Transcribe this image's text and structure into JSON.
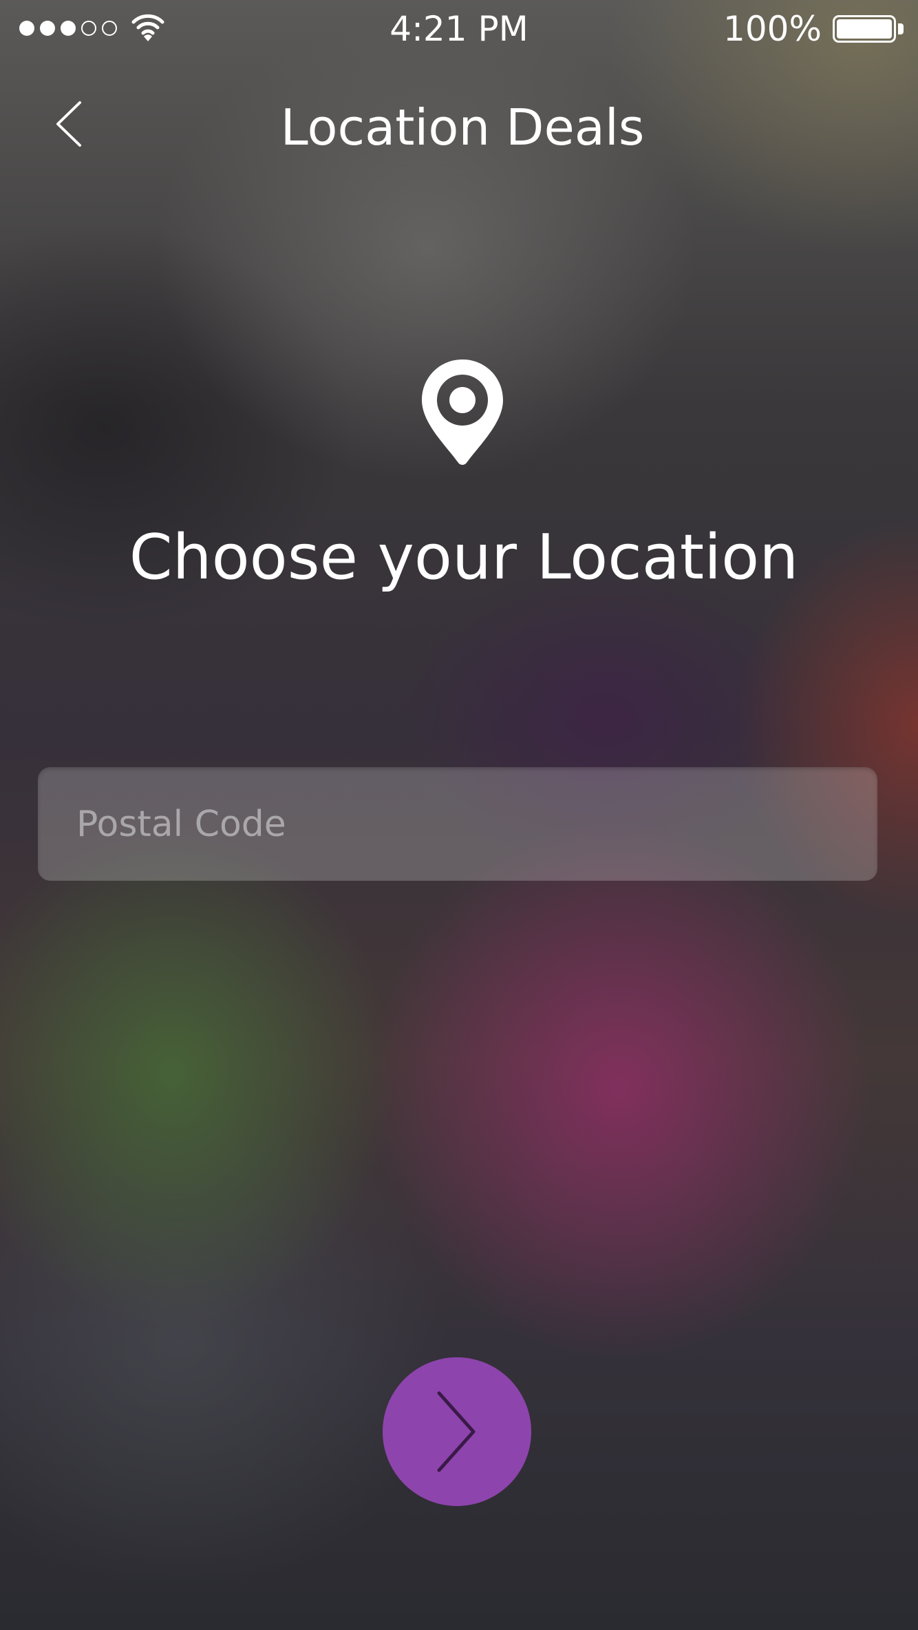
{
  "status_bar": {
    "signal_bars_filled": 3,
    "signal_bars_total": 5,
    "wifi_icon": "wifi-icon",
    "time": "4:21 PM",
    "battery_percent": "100%",
    "battery_level": 1.0
  },
  "nav": {
    "back_icon": "chevron-left-icon",
    "title": "Location Deals"
  },
  "main": {
    "pin_icon": "map-pin-icon",
    "heading": "Choose your Location",
    "postal_code": {
      "value": "",
      "placeholder": "Postal Code"
    },
    "next_button": {
      "icon": "chevron-right-icon",
      "color": "#8e44ad"
    }
  },
  "colors": {
    "accent": "#8e44ad",
    "text": "#ffffff",
    "placeholder": "rgba(255,255,255,0.45)"
  }
}
